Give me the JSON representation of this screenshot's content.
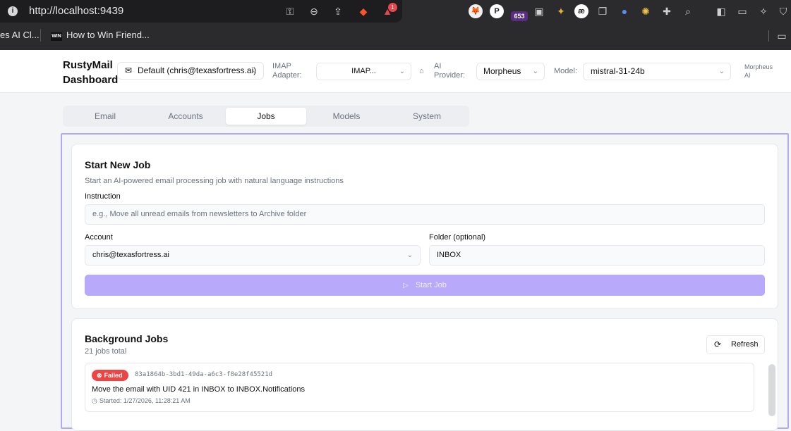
{
  "browser": {
    "url": "http://localhost:9439",
    "bookmarks": [
      "es AI Cl...",
      "How to Win Friend..."
    ],
    "bookmark_badge": "WIN",
    "ext_badge_count": "653",
    "brave_badge": "1"
  },
  "header": {
    "brand_line1": "RustyMail",
    "brand_line2": "Dashboard",
    "account_select": "Default (chris@texasfortress.ai)",
    "imap_label_line1": "IMAP",
    "imap_label_line2": "Adapter:",
    "imap_select": "IMAP...",
    "ai_label_line1": "AI",
    "ai_label_line2": "Provider:",
    "ai_select": "Morpheus",
    "model_label": "Model:",
    "model_select": "mistral-31-24b",
    "provider_tag_line1": "Morpheus",
    "provider_tag_line2": "AI"
  },
  "tabs": [
    {
      "label": "Email",
      "active": false
    },
    {
      "label": "Accounts",
      "active": false
    },
    {
      "label": "Jobs",
      "active": true
    },
    {
      "label": "Models",
      "active": false
    },
    {
      "label": "System",
      "active": false
    }
  ],
  "start_job": {
    "title": "Start New Job",
    "subtitle": "Start an AI-powered email processing job with natural language instructions",
    "instruction_label": "Instruction",
    "instruction_placeholder": "e.g., Move all unread emails from newsletters to Archive folder",
    "account_label": "Account",
    "account_value": "chris@texasfortress.ai",
    "folder_label": "Folder (optional)",
    "folder_value": "INBOX",
    "button_label": "Start Job"
  },
  "background_jobs": {
    "title": "Background Jobs",
    "count_text": "21 jobs total",
    "refresh_label": "Refresh",
    "jobs": [
      {
        "status": "Failed",
        "id": "83a1864b-3bd1-49da-a6c3-f8e28f45521d",
        "description": "Move the email with UID 421 in INBOX to INBOX.Notifications",
        "started": "Started: 1/27/2026, 11:28:21 AM"
      }
    ]
  },
  "colors": {
    "accent": "#b8a9fb",
    "panel_border": "#b3a8f5",
    "failed": "#ef4444"
  }
}
